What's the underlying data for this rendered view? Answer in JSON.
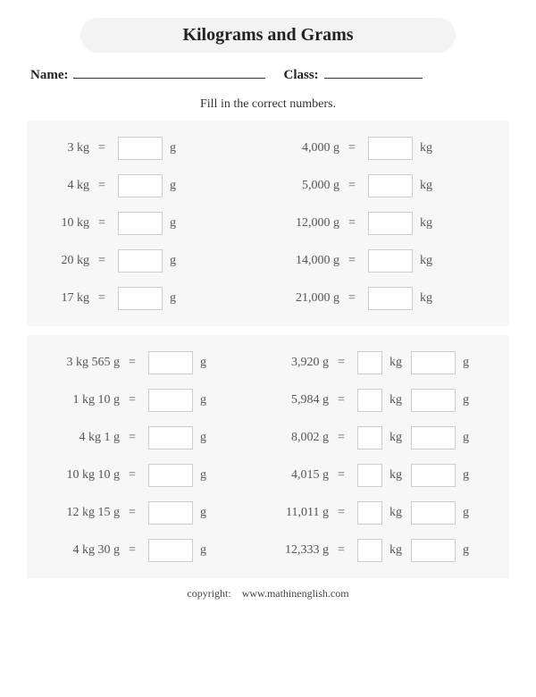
{
  "title": "Kilograms and Grams",
  "name_label": "Name:",
  "class_label": "Class:",
  "instructions": "Fill in the correct numbers.",
  "footer_label": "copyright:",
  "footer_site": "www.mathinenglish.com",
  "eq": "=",
  "unit_g": "g",
  "unit_kg": "kg",
  "s1": {
    "left": [
      "3 kg",
      "4 kg",
      "10 kg",
      "20 kg",
      "17 kg"
    ],
    "right": [
      "4,000 g",
      "5,000 g",
      "12,000 g",
      "14,000 g",
      "21,000 g"
    ]
  },
  "s2": {
    "left": [
      "3 kg 565 g",
      "1 kg   10 g",
      "4 kg     1 g",
      "10 kg   10 g",
      "12 kg   15 g",
      "4 kg   30 g"
    ],
    "right": [
      "3,920 g",
      "5,984 g",
      "8,002 g",
      "4,015 g",
      "11,011 g",
      "12,333 g"
    ]
  }
}
